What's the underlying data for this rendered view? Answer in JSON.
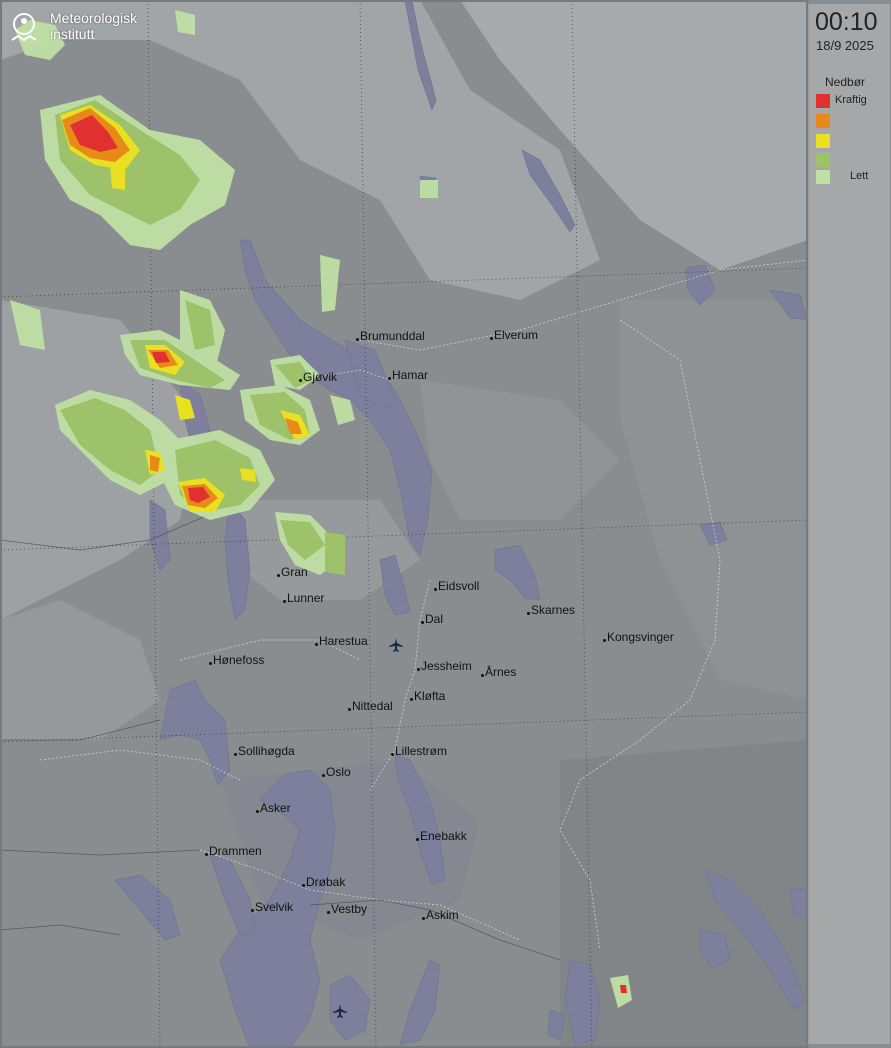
{
  "branding": {
    "line1": "Meteorologisk",
    "line2": "institutt"
  },
  "timestamp": {
    "time": "00:10",
    "date": "18/9 2025"
  },
  "legend": {
    "title": "Nedbør",
    "items": [
      {
        "label": "Kraftig",
        "color": "#e03030"
      },
      {
        "label": "",
        "color": "#e88a1a"
      },
      {
        "label": "",
        "color": "#e8e020"
      },
      {
        "label": "",
        "color": "#9ec26a"
      },
      {
        "label": "Lett",
        "color": "#bfe0a4"
      }
    ]
  },
  "places": [
    {
      "name": "Brumunddal"
    },
    {
      "name": "Elverum"
    },
    {
      "name": "Gjøvik"
    },
    {
      "name": "Hamar"
    },
    {
      "name": "Eidsvoll"
    },
    {
      "name": "Gran"
    },
    {
      "name": "Skarnes"
    },
    {
      "name": "Lunner"
    },
    {
      "name": "Dal"
    },
    {
      "name": "Kongsvinger"
    },
    {
      "name": "Harestua"
    },
    {
      "name": "Hønefoss"
    },
    {
      "name": "Jessheim"
    },
    {
      "name": "Årnes"
    },
    {
      "name": "Kløfta"
    },
    {
      "name": "Nittedal"
    },
    {
      "name": "Sollihøgda"
    },
    {
      "name": "Lillestrøm"
    },
    {
      "name": "Oslo"
    },
    {
      "name": "Asker"
    },
    {
      "name": "Enebakk"
    },
    {
      "name": "Drammen"
    },
    {
      "name": "Drøbak"
    },
    {
      "name": "Svelvik"
    },
    {
      "name": "Vestby"
    },
    {
      "name": "Askim"
    }
  ],
  "airports": [
    {
      "name": "airport"
    },
    {
      "name": "airport"
    }
  ],
  "colors": {
    "water": "#7d7f9c",
    "land": "#8b8e91",
    "highland": "#a3a6a8"
  }
}
